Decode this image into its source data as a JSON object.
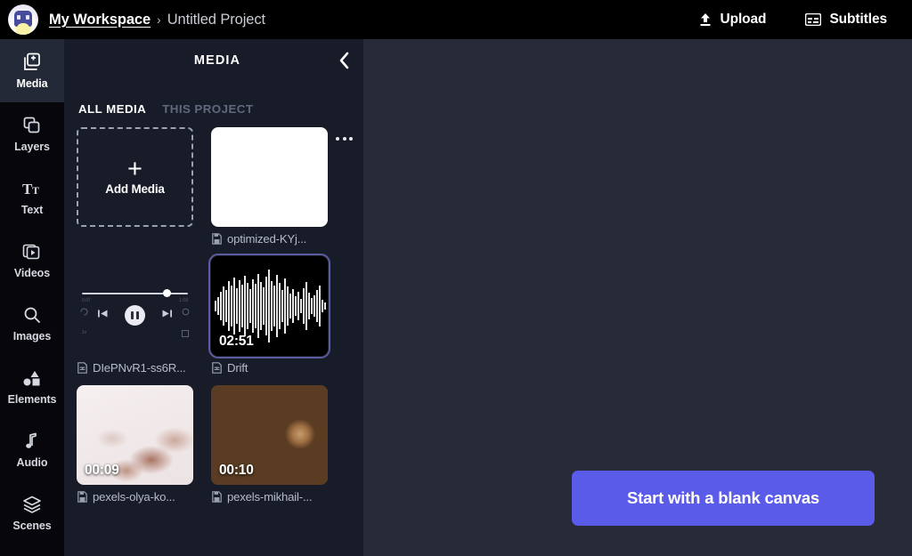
{
  "topbar": {
    "avatar_name": "workspace-avatar",
    "workspace": "My Workspace",
    "separator": "›",
    "project": "Untitled Project",
    "upload_label": "Upload",
    "upload_icon": "upload-icon",
    "subtitles_label": "Subtitles",
    "subtitles_icon": "subtitles-icon"
  },
  "rail": {
    "items": [
      {
        "label": "Media",
        "icon": "media-icon",
        "active": true
      },
      {
        "label": "Layers",
        "icon": "layers-icon",
        "active": false
      },
      {
        "label": "Text",
        "icon": "text-icon",
        "active": false
      },
      {
        "label": "Videos",
        "icon": "videos-icon",
        "active": false
      },
      {
        "label": "Images",
        "icon": "images-icon",
        "active": false
      },
      {
        "label": "Elements",
        "icon": "elements-icon",
        "active": false
      },
      {
        "label": "Audio",
        "icon": "audio-icon",
        "active": false
      },
      {
        "label": "Scenes",
        "icon": "scenes-icon",
        "active": false
      }
    ]
  },
  "panel": {
    "title": "MEDIA",
    "collapse_icon": "chevron-left-icon",
    "more_icon": "more-options-icon",
    "tabs": [
      {
        "label": "ALL MEDIA",
        "selected": true
      },
      {
        "label": "THIS PROJECT",
        "selected": false
      }
    ],
    "add_media": {
      "plus": "+",
      "label": "Add Media",
      "icon": "plus-icon"
    },
    "items": [
      {
        "name": "optimized-KYj...",
        "kind": "image",
        "duration": "",
        "selected": false,
        "file_icon": "file-image-icon"
      },
      {
        "name": "DIePNvR1-ss6R...",
        "kind": "audio-player",
        "duration": "",
        "selected": false,
        "file_icon": "file-audio-icon",
        "player": {
          "play_icon": "pause-icon",
          "prev_icon": "skip-back-icon",
          "next_icon": "skip-forward-icon",
          "progress_percent": 75
        }
      },
      {
        "name": "Drift",
        "kind": "audio",
        "duration": "02:51",
        "selected": true,
        "file_icon": "file-audio-icon"
      },
      {
        "name": "pexels-olya-ko...",
        "kind": "video",
        "duration": "00:09",
        "selected": false,
        "file_icon": "file-video-icon"
      },
      {
        "name": "pexels-mikhail-...",
        "kind": "video",
        "duration": "00:10",
        "selected": false,
        "file_icon": "file-video-icon"
      }
    ]
  },
  "canvas": {
    "cta_label": "Start with a blank canvas"
  },
  "colors": {
    "topbar_bg": "#000000",
    "rail_bg": "#07070b",
    "rail_active_bg": "#242938",
    "panel_bg": "#171c28",
    "canvas_bg": "#272b38",
    "accent": "#5b5bea",
    "selection_border": "#5d5c9e",
    "text_primary": "#ffffff",
    "text_muted": "#b6bbc7",
    "tab_inactive": "#60697d"
  }
}
